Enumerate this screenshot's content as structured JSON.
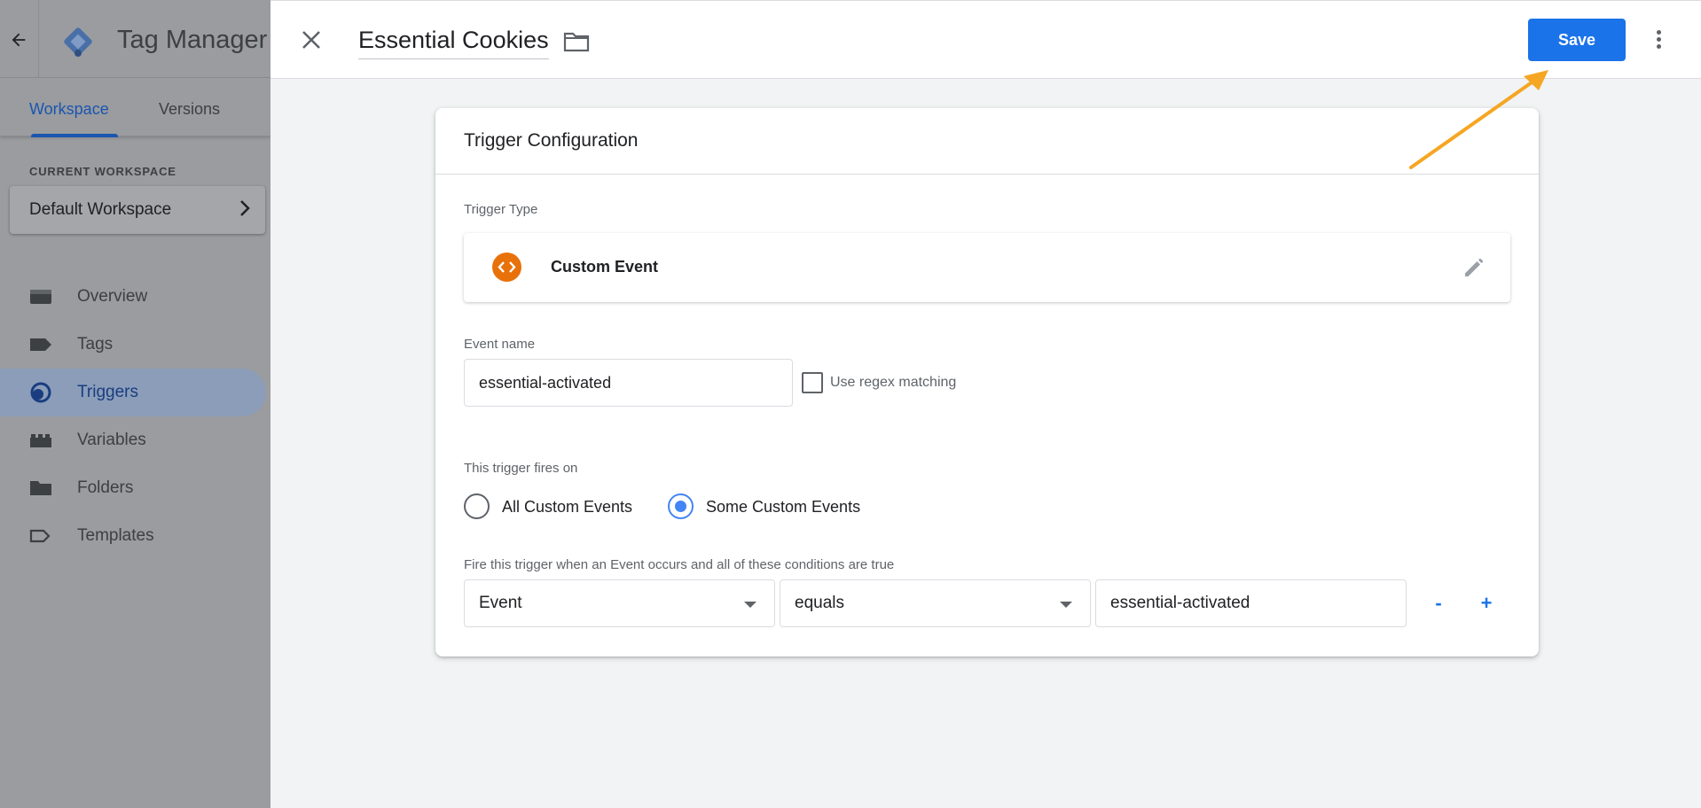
{
  "app": {
    "title": "Tag Manager",
    "tabs": [
      {
        "label": "Workspace",
        "active": true
      },
      {
        "label": "Versions",
        "active": false
      }
    ],
    "current_workspace_label": "CURRENT WORKSPACE",
    "workspace_name": "Default Workspace",
    "nav": [
      {
        "label": "Overview",
        "icon": "overview-icon",
        "active": false
      },
      {
        "label": "Tags",
        "icon": "tag-icon",
        "active": false
      },
      {
        "label": "Triggers",
        "icon": "trigger-icon",
        "active": true
      },
      {
        "label": "Variables",
        "icon": "variables-icon",
        "active": false
      },
      {
        "label": "Folders",
        "icon": "folder-icon",
        "active": false
      },
      {
        "label": "Templates",
        "icon": "template-icon",
        "active": false
      }
    ]
  },
  "header": {
    "title": "Essential Cookies",
    "save_label": "Save"
  },
  "card": {
    "title": "Trigger Configuration",
    "trigger_type_label": "Trigger Type",
    "trigger_type_name": "Custom Event",
    "event_name_label": "Event name",
    "event_name_value": "essential-activated",
    "regex_label": "Use regex matching",
    "regex_checked": false,
    "fires_on_label": "This trigger fires on",
    "fires_on_options": [
      {
        "label": "All Custom Events",
        "checked": false
      },
      {
        "label": "Some Custom Events",
        "checked": true
      }
    ],
    "condition_label": "Fire this trigger when an Event occurs and all of these conditions are true",
    "condition": {
      "variable": "Event",
      "operator": "equals",
      "value": "essential-activated"
    },
    "remove_label": "-",
    "add_label": "+"
  },
  "colors": {
    "accent": "#1a73e8",
    "custom_event_icon": "#e8710a",
    "annotation_arrow": "#f5a623"
  }
}
